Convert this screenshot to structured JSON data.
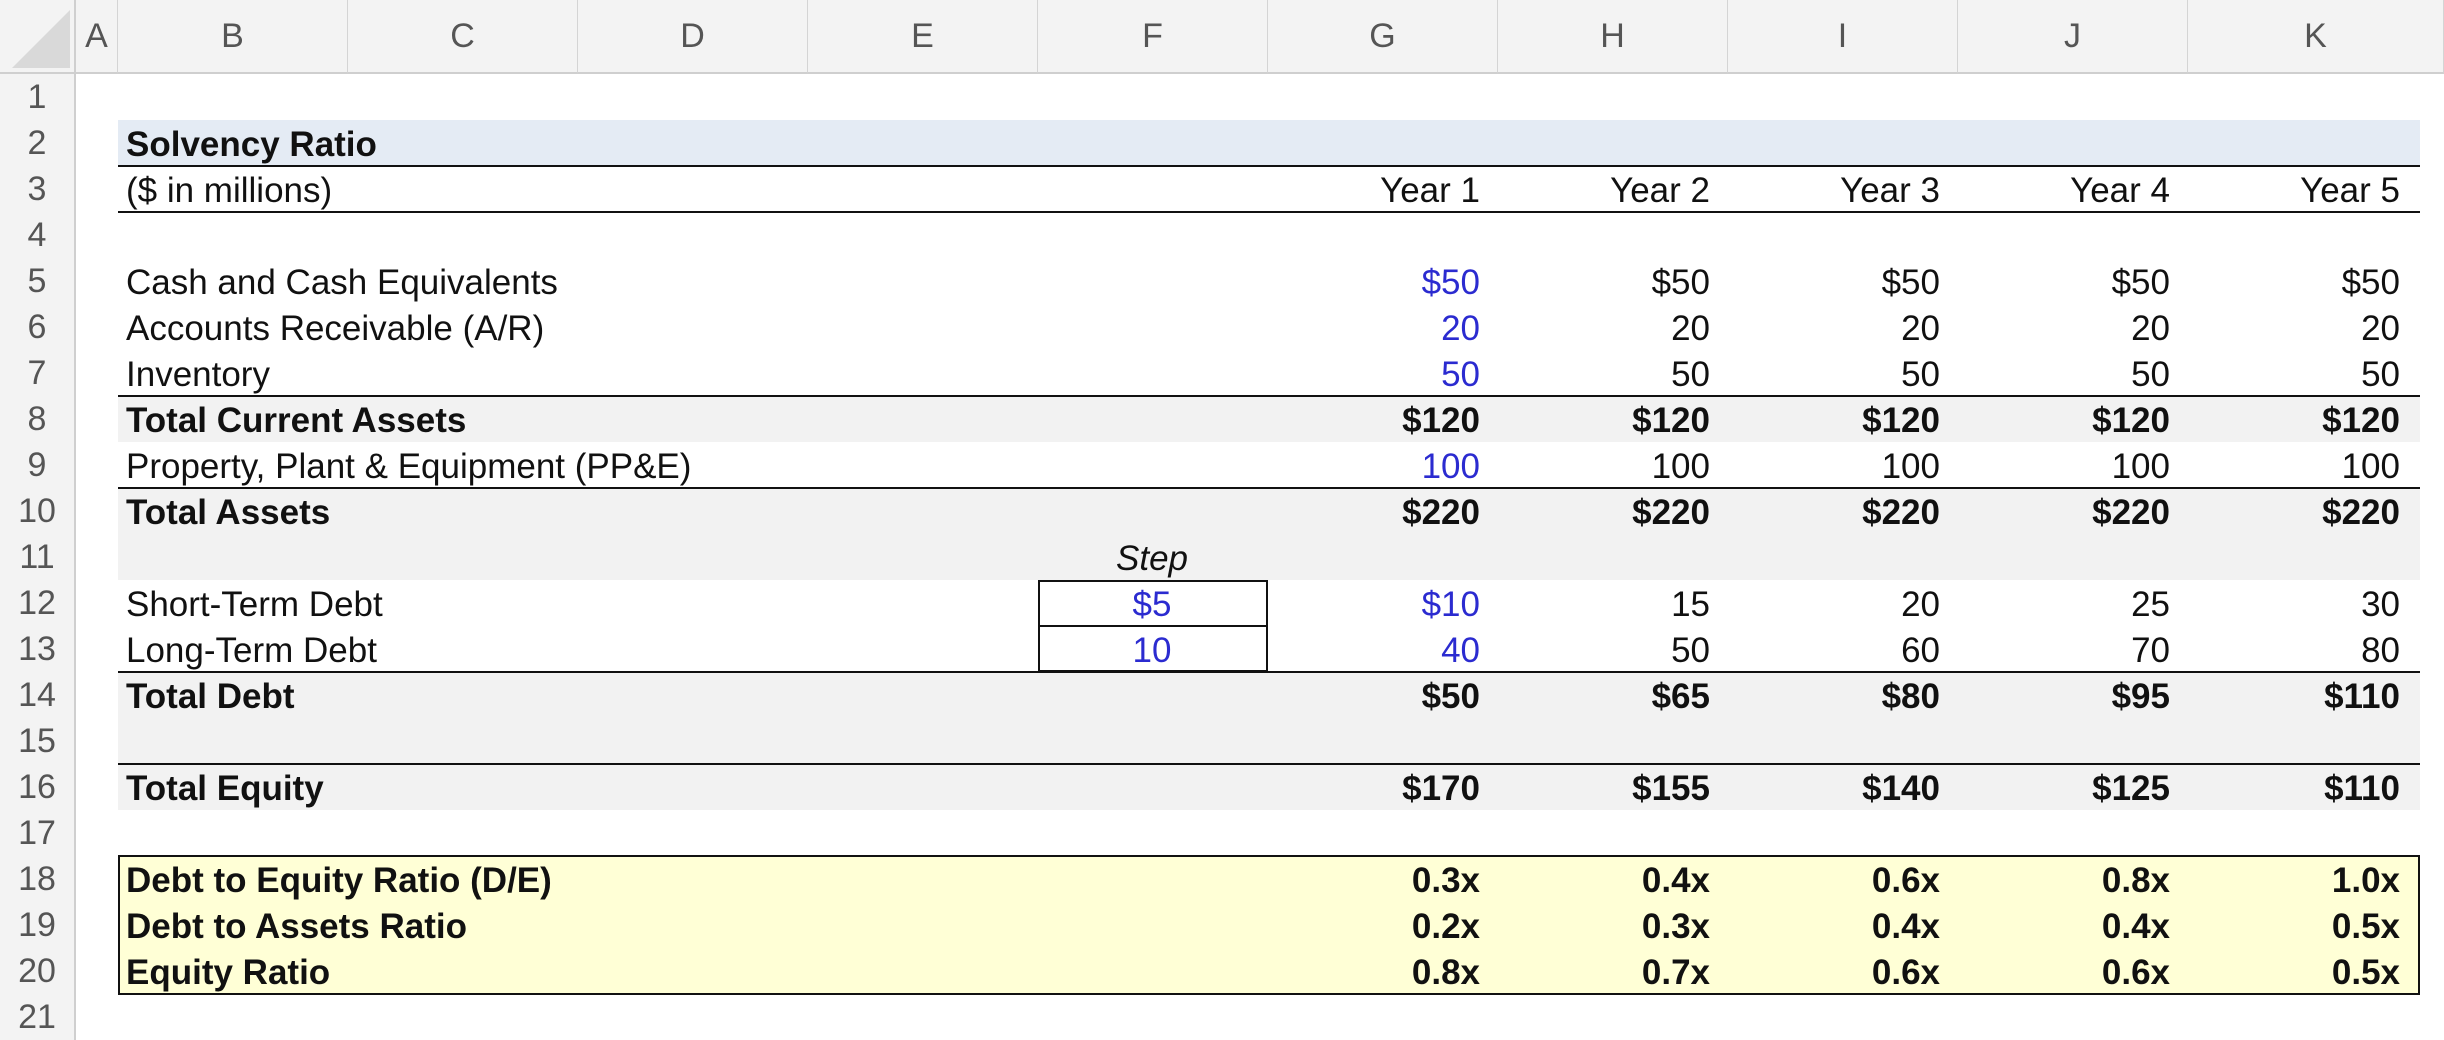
{
  "columns": [
    "A",
    "B",
    "C",
    "D",
    "E",
    "F",
    "G",
    "H",
    "I",
    "J",
    "K"
  ],
  "rows": [
    "1",
    "2",
    "3",
    "4",
    "5",
    "6",
    "7",
    "8",
    "9",
    "10",
    "11",
    "12",
    "13",
    "14",
    "15",
    "16",
    "17",
    "18",
    "19",
    "20",
    "21"
  ],
  "title": "Solvency Ratio",
  "units": "($ in millions)",
  "years": [
    "Year 1",
    "Year 2",
    "Year 3",
    "Year 4",
    "Year 5"
  ],
  "step_label": "Step",
  "step_short": "$5",
  "step_long": "10",
  "lines": [
    {
      "label": "Cash and Cash Equivalents",
      "values": [
        "$50",
        "$50",
        "$50",
        "$50",
        "$50"
      ]
    },
    {
      "label": "Accounts Receivable (A/R)",
      "values": [
        "20",
        "20",
        "20",
        "20",
        "20"
      ]
    },
    {
      "label": "Inventory",
      "values": [
        "50",
        "50",
        "50",
        "50",
        "50"
      ]
    },
    {
      "label": "Total Current Assets",
      "values": [
        "$120",
        "$120",
        "$120",
        "$120",
        "$120"
      ]
    },
    {
      "label": "Property, Plant & Equipment (PP&E)",
      "values": [
        "100",
        "100",
        "100",
        "100",
        "100"
      ]
    },
    {
      "label": "Total Assets",
      "values": [
        "$220",
        "$220",
        "$220",
        "$220",
        "$220"
      ]
    },
    {
      "label": "Short-Term Debt",
      "values": [
        "$10",
        "15",
        "20",
        "25",
        "30"
      ]
    },
    {
      "label": "Long-Term Debt",
      "values": [
        "40",
        "50",
        "60",
        "70",
        "80"
      ]
    },
    {
      "label": "Total Debt",
      "values": [
        "$50",
        "$65",
        "$80",
        "$95",
        "$110"
      ]
    },
    {
      "label": "Total Equity",
      "values": [
        "$170",
        "$155",
        "$140",
        "$125",
        "$110"
      ]
    },
    {
      "label": "Debt to Equity Ratio (D/E)",
      "values": [
        "0.3x",
        "0.4x",
        "0.6x",
        "0.8x",
        "1.0x"
      ]
    },
    {
      "label": "Debt to Assets Ratio",
      "values": [
        "0.2x",
        "0.3x",
        "0.4x",
        "0.4x",
        "0.5x"
      ]
    },
    {
      "label": "Equity Ratio",
      "values": [
        "0.8x",
        "0.7x",
        "0.6x",
        "0.6x",
        "0.5x"
      ]
    }
  ],
  "colors": {
    "title_band": "#e4ebf4",
    "total_band": "#f2f2f2",
    "ratio_band": "#ffffd6",
    "input_blue": "#2b2bd0"
  }
}
